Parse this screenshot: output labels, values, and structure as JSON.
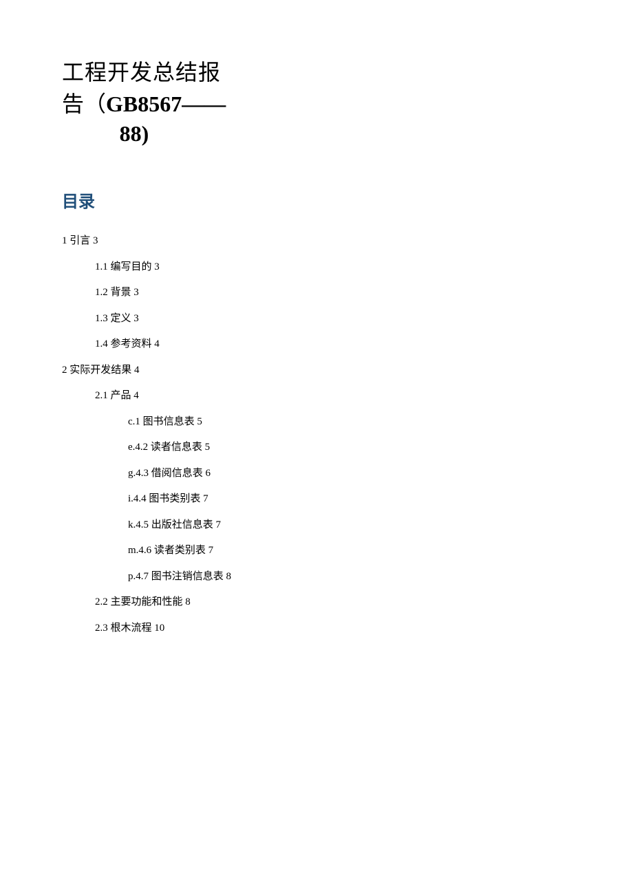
{
  "title": {
    "line1": "工程开发总结报",
    "line2_a": "告（",
    "line2_b": "GB8567——",
    "line3": "88)"
  },
  "toc_heading": "目录",
  "toc": [
    {
      "level": 1,
      "text": "1 引言 3"
    },
    {
      "level": 2,
      "text": "1.1 编写目的 3"
    },
    {
      "level": 2,
      "text": "1.2 背景 3"
    },
    {
      "level": 2,
      "text": "1.3 定义 3"
    },
    {
      "level": 2,
      "text": "1.4 参考资料 4"
    },
    {
      "level": 1,
      "text": "2 实际开发结果 4"
    },
    {
      "level": 2,
      "text": "2.1 产品 4"
    },
    {
      "level": 3,
      "text": "c.1 图书信息表 5"
    },
    {
      "level": 3,
      "text": "e.4.2 读者信息表 5"
    },
    {
      "level": 3,
      "text": "g.4.3 借阅信息表 6"
    },
    {
      "level": 3,
      "text": "i.4.4 图书类别表 7"
    },
    {
      "level": 3,
      "text": "k.4.5 出版社信息表 7"
    },
    {
      "level": 3,
      "text": "m.4.6 读者类别表 7"
    },
    {
      "level": 3,
      "text": "p.4.7 图书注销信息表 8"
    },
    {
      "level": 2,
      "text": "2.2 主要功能和性能 8"
    },
    {
      "level": 2,
      "text": "2.3 根木流程 10"
    }
  ]
}
